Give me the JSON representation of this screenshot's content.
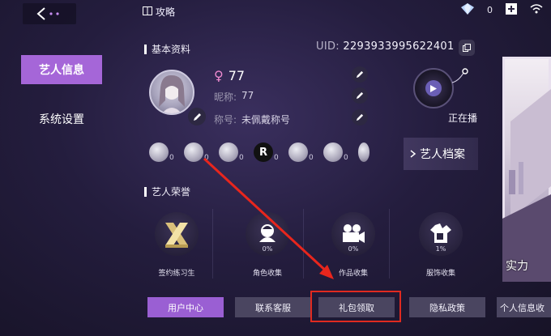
{
  "header": {
    "guide_label": "攻略",
    "gem_count": "0"
  },
  "nav": {
    "artist_info": "艺人信息",
    "system_settings": "系统设置"
  },
  "basic_info": {
    "title": "基本资料",
    "uid_label": "UID:",
    "uid_value": "2293933995622401",
    "gender_symbol": "♀",
    "level": "77",
    "nickname_label": "昵称:",
    "nickname_value": "77",
    "title_label": "称号:",
    "title_value": "未佩戴称号",
    "music_label": "正在播",
    "profile_card_label": "艺人档案"
  },
  "badges": [
    {
      "glyph": "",
      "count": "0"
    },
    {
      "glyph": "",
      "count": "0"
    },
    {
      "glyph": "",
      "count": "0"
    },
    {
      "glyph": "R",
      "count": "0"
    },
    {
      "glyph": "",
      "count": "0"
    },
    {
      "glyph": "",
      "count": "0"
    },
    {
      "glyph": "",
      "count": ""
    }
  ],
  "honors": {
    "title": "艺人荣誉",
    "items": [
      {
        "label": "签约练习生",
        "pct": "",
        "icon": "x-trophy-icon"
      },
      {
        "label": "角色收集",
        "pct": "0%",
        "icon": "character-icon"
      },
      {
        "label": "作品收集",
        "pct": "0%",
        "icon": "film-camera-icon"
      },
      {
        "label": "服饰收集",
        "pct": "1%",
        "icon": "outfit-icon"
      }
    ]
  },
  "bottom_buttons": {
    "user_center": "用户中心",
    "contact_support": "联系客服",
    "gift_pack": "礼包领取",
    "privacy_policy": "隐私政策",
    "personal_info": "个人信息收"
  },
  "art_text": "实力",
  "colors": {
    "accent": "#a566d8",
    "highlight": "#e02a20",
    "arrow": "#e8261d"
  }
}
